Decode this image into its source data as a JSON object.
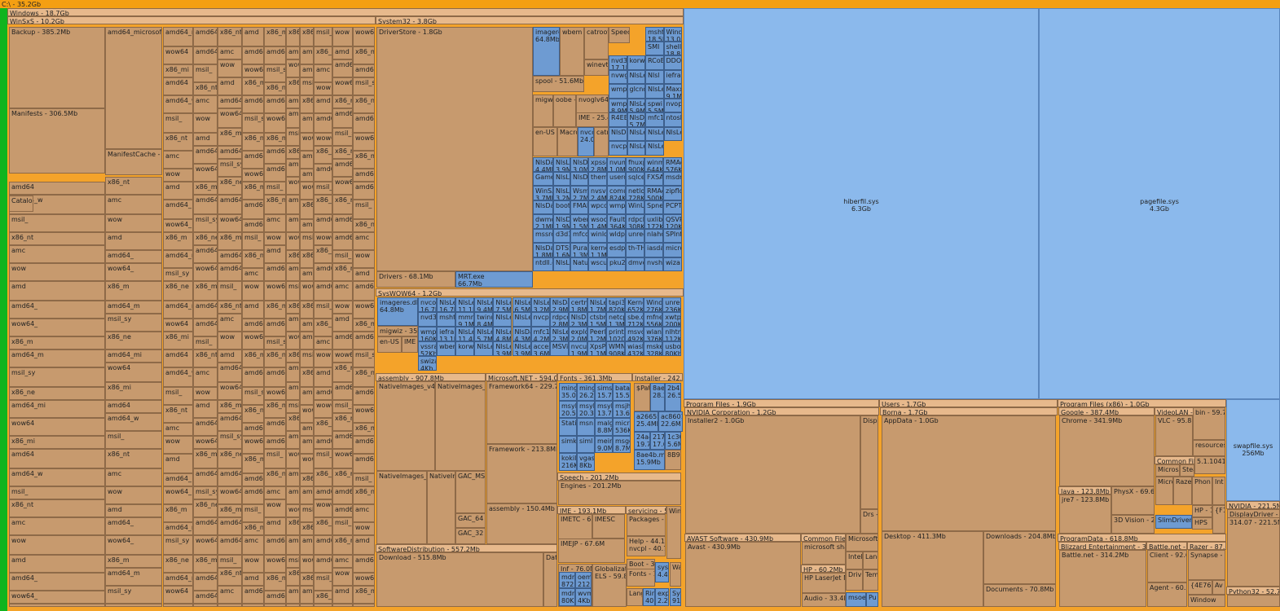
{
  "root": "C:\\ - 35.2Gb",
  "colors": {
    "root": "#f49f12",
    "folder": "#c79a6e",
    "header": "#e7b98c",
    "file": "#6e9bd2",
    "large_file": "#8bb9ec",
    "left_strip": "#10b41e"
  },
  "folders": {
    "windows": "Windows - 18.7Gb",
    "winsxs": "WinSxS - 10.2Gb",
    "backup": "Backup - 385.2Mb",
    "manifests": "Manifests - 306.5Mb",
    "catalogs": "Catalogs - 3",
    "manifestcache": "ManifestCache - 53",
    "system32": "System32 - 3.8Gb",
    "driverstore": "DriverStore - 1.8Gb",
    "drivers": "Drivers - 68.1Mb",
    "syswow64": "SysWOW64 - 1.2Gb",
    "assembly": "assembly - 907.8Mb",
    "dotnet": "Microsoft.NET - 594.0Mb",
    "framework64": "Framework64 - 229.7M",
    "framework": "Framework - 213.8Mb",
    "assembly2": "assembly - 150.4Mb",
    "fonts": "Fonts - 361.3Mb",
    "installer": "Installer - 242.2M",
    "speech": "Speech - 201.2Mb",
    "engines": "Engines - 201.2Mb",
    "ime": "IME - 193.1Mb",
    "imetc": "IMETC - 68.0M",
    "imejp": "IMEJP - 67.6M",
    "servicing": "servicing - 58",
    "packages": "Packages - 5",
    "softdist": "SoftwareDistribution - 557.2Mb",
    "download": "Download - 515.8Mb",
    "progfiles": "Program Files - 1.9Gb",
    "nvidiacorp": "NVIDIA Corporation - 1.2Gb",
    "installer2": "Installer2 - 1.0Gb",
    "avast": "AVAST Software - 430.9Mb",
    "avast2": "Avast - 430.9Mb",
    "commonfiles": "Common Files",
    "hp": "HP - 60.2Mb",
    "hplaserjet": "HP LaserJet M",
    "audio": "Audio - 33.4M",
    "users": "Users - 1.7Gb",
    "borna": "Borna - 1.7Gb",
    "appdata": "AppData - 1.0Gb",
    "desktop": "Desktop - 411.3Mb",
    "downloads": "Downloads - 204.8Mb",
    "documents": "Documents - 70.8Mb",
    "progx86": "Program Files (x86) - 1.0Gb",
    "google": "Google - 387.4Mb",
    "chrome": "Chrome - 341.9Mb",
    "videolan": "VideoLAN - 9",
    "vlc": "VLC - 95.8M",
    "java": "Java - 123.8Mb",
    "jre7": "jre7 - 123.8Mb",
    "physx": "PhysX - 69.6M",
    "vision3d": "3D Vision - 2",
    "programdata": "ProgramData - 618.8Mb",
    "blizzard": "Blizzard Entertainment - 314.8",
    "battlenet": "Battle.net - 314.2Mb",
    "battlenet2": "Battle.net - 15",
    "razer": "Razer - 87.0M",
    "client": "Client - 92.6M",
    "synapse": "Synapse - 8",
    "agent": "Agent - 60.5M",
    "nvidia2": "NVIDIA - 221.5M",
    "displaydriver": "DisplayDriver - 2",
    "ver": "314.07 - 221.5M",
    "python": "Python32 - 52.7M"
  },
  "files": {
    "hiberfil": "hiberfil.sys\n6.3Gb",
    "pagefile": "pagefile.sys\n4.3Gb",
    "swapfile": "swapfile.sys\n256Mb",
    "mrt": "MRT.exe\n66.7Mb",
    "imageres": "imageres\n64.8Mb",
    "imageres2": "imageres.dll\n64.8Mb",
    "slimdrivers": "SlimDrivers."
  },
  "cells": {
    "winsxs_prefixes": [
      "amd64_",
      "wow64_",
      "x86_m",
      "amd64_m",
      "msil_sy",
      "x86_ne",
      "amd64_mi",
      "wow64",
      "x86_mi",
      "amd64",
      "amd64_w",
      "msil_",
      "x86_nt",
      "amc",
      "wow",
      "amd"
    ],
    "driverstore_labels": [
      "NlsDat\n4.4Mb",
      "NlsLe\n3.9M",
      "NlsDa\n3.0Mb",
      "xpsse\n2.8M",
      "nvumi\n1.0Mb",
      "fhuxp\n900Kb",
      "winmg\n644Kb",
      "RMAc\n576Kb",
      "Gamel",
      "NlsLe",
      "NlsDa",
      "them",
      "userc",
      "sqlcec",
      "FXSA",
      "msdm",
      "WinSA\n3.7Mb",
      "NlsLe\n3.2M",
      "WsmS\n2.7M",
      "nvsvc\n2.4M",
      "comui\n824Kb",
      "netlog\n728Kb",
      "RMAc\n500Kb",
      "zipfldr",
      "NlsDat",
      "bootu",
      "FMAI",
      "wpcca",
      "wmpe",
      "WinUS",
      "Spnet",
      "PCPT",
      "dwmc\n2.1Mb",
      "NlsDa\n1.9M",
      "wbem\n1.5Mb",
      "wsock\n1.4M",
      "Faultr\n364Kb",
      "rdpcli\n308Kb",
      "uxlib.d\n172Kb",
      "QSVR\n120Kb",
      "mssrch",
      "d3d11",
      "mfcore",
      "winlo",
      "wldpr",
      "unregi",
      "nlahc",
      "SPInf",
      "NlsDa\n1.8Mb",
      "DTSS\n1.6M",
      "Puran\n1.3M",
      "kerne\n1.1M",
      "esdpar",
      "th-TH",
      "iasdat",
      "micros",
      "ntdll.d",
      "NlsLe",
      "Natur",
      "wscui",
      "pku2u",
      "dmvdl",
      "nvshe",
      "wiza"
    ],
    "syswow_labels": [
      "nvcon\n16.7M",
      "NlsLe\n16.7M",
      "NlsLex\n11.1M",
      "NlsLe\n9.4M",
      "NlsLex\n7.5Mb",
      "NlsLe\n6.5M",
      "NlsLex\n3.2Mb",
      "NlsDa\n2.9M",
      "certm\n1.8Mb",
      "NlsLe\n1.7M",
      "tapi3.d\n820Kb",
      "Kerne\n652Kb",
      "Windo\n276Kb",
      "unreg\n236Kb",
      "nvd3d",
      "mshtr",
      "mmres\n9.1Mb",
      "twinu\n8.4Mb",
      "NlsLe",
      "NlsLex",
      "nvcp",
      "rdpcon\n2.8Mb",
      "NlsDa\n2.3M",
      "ctsbrk\n1.5Mb",
      "netcp\n1.3M",
      "sbe.dl\n712Kb",
      "mfnet\n556Kb",
      "xwtpd\n200Kb",
      "wmpd\n160Kb",
      "iefram\n13.1M",
      "NlsLe\n11.4M",
      "NlsLex\n5.7Mb",
      "NlsLe\n4.8M",
      "NlsDa\n4.3Mb",
      "mfc1\n4.2M",
      "NlsLex\n2.3M",
      "explor\n2.0M",
      "PeerD\n1.2M",
      "printu\n1020K",
      "msvcp\n492Kb",
      "wlang\n376Kb",
      "nlhtml\n112Kb",
      "vssrar\n52Kb",
      "wbem",
      "korwl",
      "NlsLex",
      "NlsLe\n3.9M",
      "NlsLe\n3.9M",
      "acces\n3.6M",
      "MSVic",
      "nvcuv\n1.9M",
      "XpsPri\n1.1Mb",
      "WMN\n908Kb",
      "wiash\n432Kb",
      "mskeu\n328Kb",
      "usboe\n80Kb",
      "swizar\n4Kb"
    ],
    "fonts_labels": [
      "mingliu\n35.0Mb",
      "mingl\n26.2M",
      "simsu\n15.7M",
      "batar\n15.5M",
      "msyh.\n20.5M",
      "msyh\n20.3M",
      "msyhl\n13.7M",
      "msjhb\n13.6M",
      "StaticCa",
      "msn",
      "malgu\n8.8Mb",
      "micro\n536K",
      "simkai.t",
      "siml",
      "meiryi\n9.0Mb",
      "msgoth\n8.7M",
      "kokila\n216Kb",
      "vgaso\n8Kb"
    ],
    "installer_labels": [
      "$Pat",
      "8ae3\n28.3M",
      "2b42\n26.5M",
      "a2665S\n25.4Mb",
      "ac8601\n22.6M",
      "24a4\n19.7M",
      "2177\n17.6M",
      "1c307\n5.6Mb",
      "8ae4b.ms\n15.9Mb",
      "8B92"
    ]
  }
}
